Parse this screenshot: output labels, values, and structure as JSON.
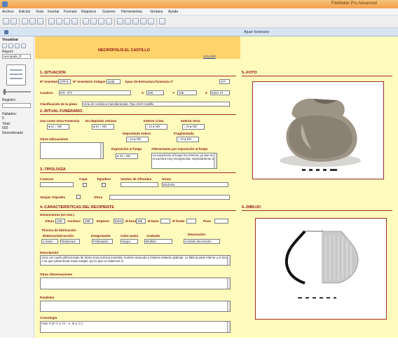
{
  "app": {
    "title": "FileMaker Pro Advanced"
  },
  "menu": [
    "Archivo",
    "Edición",
    "Vista",
    "Insertar",
    "Formato",
    "Registros",
    "Guiones",
    "Herramientas",
    "Ventana",
    "Ayuda"
  ],
  "layout_bar": {
    "name": "Ajuar funerario"
  },
  "status": {
    "mode": "Visualizar",
    "layout_label": "Report:",
    "layout_value": "necropolis_fl",
    "record_label": "Registro:",
    "record_value": "",
    "found_label": "Hallados:",
    "found_value": "5",
    "total_label": "Total:",
    "total_value": "593",
    "sort": "Desordenado"
  },
  "header": {
    "title": "NECRÓPOLIS EL CASTILLO",
    "link": "VOLVER"
  },
  "sections": {
    "situacion": "1.-SITUACIÓN",
    "ritual": "2.-RITUAL FUNERARIO",
    "tipologia": "3.-TIPOLOGÍA",
    "caracteristicas": "4.-CARACTERÍSTICAS DEL RECIPIENTE",
    "foto": "5.-FOTO",
    "dibujo": "6.-DIBUJO"
  },
  "situacion": {
    "inventario_label": "Nº Inventario",
    "inventario_value": "CPP 8",
    "inventario_antiguo_label": "Nº Inventario Antiguo",
    "inventario_antiguo_value": "3165",
    "ajuar_label": "Ajuar de Estructura funeraria nº",
    "ajuar_value": "377",
    "cuadros_label": "Cuadros",
    "cuadros_value": "8°8 - 8°3",
    "x_label": "X",
    "x_value": "200",
    "y_label": "Y",
    "y_value": "105",
    "z_label": "Z",
    "z_value": "Entre 2T",
    "clasificacion_label": "Clasificación de la pieza",
    "clasificacion_value": "Urna de cerámica manufacturada. Tipo 1/2/3 Castillo"
  },
  "ritual": {
    "uso_label": "Uso como Urna Funeraria",
    "uso_value": "● SI  ○ NO",
    "deposito_label": "En depósito cenizas",
    "deposito_value": "● SI  ○ NO",
    "interior_cista_label": "Interior Cista",
    "interior_cista_value": "○ SI  ● NO",
    "interior_urna_label": "Interior Urna",
    "interior_urna_value": "○ SI  ● NO",
    "depositado_label": "Depositado entera",
    "depositado_value": "○ SI  ● NO",
    "fragmentada_label": "Fragmentada",
    "fragmentada_value": "○ SI  ● NO",
    "otras_label": "Otras Ubicaciones",
    "exposicion_label": "Exposición al fuego",
    "exposicion_value": "● SI  ○ NO",
    "alteraciones_label": "Alteraciones por exposición al fuego",
    "alteraciones_value": "La exposición al fuego fue intensa, ya que se encuentra muy ennegrecida, especialmente al"
  },
  "tipologia": {
    "cuencos_label": "Cuencos",
    "copa_label": "Copa",
    "tapadera_label": "Tapadera",
    "vasitos_label": "Vasitos de Ofrendas",
    "urnas_label": "Urnas",
    "urnas_value": "Bicónica",
    "vasijas_label": "Vasijas Trípodes",
    "otros_label": "Otros"
  },
  "caracteristicas": {
    "dimensiones_label": "Dimensiones (en mm.)",
    "altura_label": "Altura",
    "altura_value": "129",
    "anchura_label": "Anchura",
    "anchura_value": "198",
    "espesor_label": "Espesor",
    "espesor_value": "Entre",
    "boca_label": "Ø boca",
    "boca_value": "166",
    "base_label": "Ø base",
    "fondo_label": "Ø fondo",
    "peso_label": "Peso",
    "tecnica_label": "Técnica de fabricación",
    "elaboracion_label": "Elaboración",
    "elaboracion_value": "A mano",
    "coccion_label": "Cocción",
    "coccion_value": "Reductora",
    "desgrasante_label": "Desgrasante",
    "desgrasante_value": "Feldespato",
    "color_label": "Color pasta",
    "color_value": "Negra",
    "acabado_label": "Acabado",
    "acabado_value": "Bruñido",
    "decoracion_label": "Decoración",
    "decoracion_value": "Lisa/Sin decoración",
    "descripcion_label": "Descripción",
    "descripcion_value": "Urna con cuello diferenciado de forma troncocónica invertida, hombro marcado y máximo saliente globular. Le falta la parte inferior y el fondo o se que solían llevar estas vasijas, por lo que no sabemos si",
    "otras_obs_label": "Otras Observaciones",
    "paralelos_label": "Paralelos",
    "cronologia_label": "Cronología",
    "cronologia_value": "Fase II (2ª ½ s. IV – s. III a. C.)"
  },
  "colors": {
    "form_bg": "#fffbbc",
    "header_bg": "#ffd36b",
    "accent": "#8a0d11",
    "titlebar": "#f1a04b"
  }
}
